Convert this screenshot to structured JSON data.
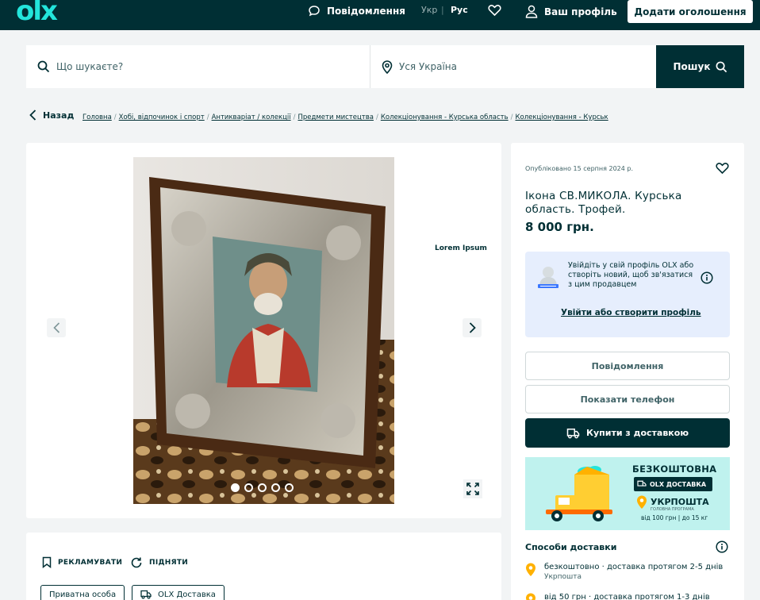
{
  "header": {
    "logo": "olx",
    "messages": "Повідомлення",
    "lang_ukr": "Укр",
    "lang_sep": "|",
    "lang_rus": "Рус",
    "profile": "Ваш профіль",
    "post_ad": "Додати оголошення"
  },
  "search": {
    "placeholder": "Що шукаєте?",
    "location": "Уся Україна",
    "button": "Пошук"
  },
  "breadcrumbs": {
    "back": "Назад",
    "items": [
      "Головна",
      "Хобі, відпочинок і спорт",
      "Антикваріат / колекції",
      "Предмети мистецтва",
      "Колекціонування - Курська область",
      "Колекціонування - Курськ"
    ]
  },
  "gallery": {
    "watermark": "Lorem Ipsum",
    "photo_count": 5,
    "active_index": 0
  },
  "listing": {
    "published": "Опубліковано 15 серпня 2024 р.",
    "title": "Ікона СВ.МИКОЛА. Курська область. Трофей.",
    "price": "8 000 грн."
  },
  "login_prompt": {
    "text": "Увійдіть у свій профіль OLX або створіть новий, щоб зв'язатися з цим продавцем",
    "link": "Увійти або створити профіль"
  },
  "buttons": {
    "message": "Повідомлення",
    "show_phone": "Показати телефон",
    "buy_delivery": "Купити з доставкою"
  },
  "banner": {
    "free": "БЕЗКОШТОВНА",
    "olx_delivery": "OLX ДОСТАВКА",
    "ukrposhta": "УКРПОШТА",
    "ukrposhta_sub": "ГОЛОВНА ПРОГРАМА",
    "note": "від 100 грн | до 15 кг"
  },
  "delivery": {
    "title": "Способи доставки",
    "options": [
      {
        "text": "безкоштовно · доставка протягом 2-5 днів",
        "sub": "Укрпошта"
      },
      {
        "text": "від 50 грн · доставка протягом 1-3 днів",
        "sub": ""
      }
    ]
  },
  "actions": {
    "promote": "РЕКЛАМУВАТИ",
    "raise": "ПІДНЯТИ",
    "chip_private": "Приватна особа",
    "chip_delivery": "OLX Доставка"
  },
  "colors": {
    "brand_dark": "#002f34",
    "brand_teal": "#23e5db",
    "banner_bg": "#bff2ee",
    "login_bg": "#e6eefd"
  }
}
